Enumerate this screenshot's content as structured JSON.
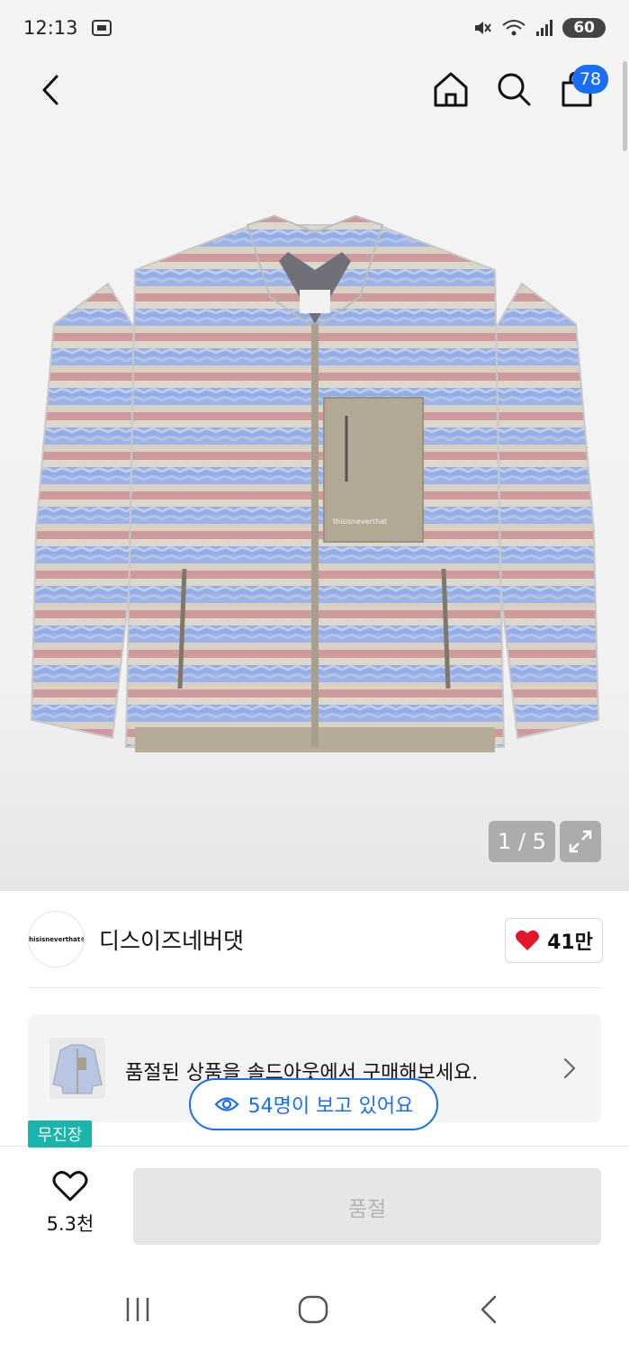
{
  "status_bar": {
    "time": "12:13",
    "battery": "60"
  },
  "nav": {
    "cart_count": "78"
  },
  "gallery": {
    "counter": "1 / 5"
  },
  "brand": {
    "logo_text": "thisisneverthat®",
    "name": "디스이즈네버댓",
    "likes": "41만"
  },
  "promo": {
    "text": "품절된 상품을 솔드아웃에서 구매해보세요."
  },
  "viewers": {
    "text": "54명이 보고 있어요"
  },
  "tag": {
    "label": "무진장"
  },
  "bottom_bar": {
    "like_count": "5.3천",
    "soldout_label": "품절"
  },
  "colors": {
    "accent": "#1a6ef5",
    "heart": "#e5162b",
    "tag": "#19b5ad"
  },
  "icons": [
    "back-icon",
    "home-icon",
    "search-icon",
    "cart-icon",
    "expand-icon",
    "heart-icon",
    "eye-icon",
    "chevron-right-icon",
    "recents-icon",
    "home-nav-icon",
    "back-nav-icon"
  ]
}
